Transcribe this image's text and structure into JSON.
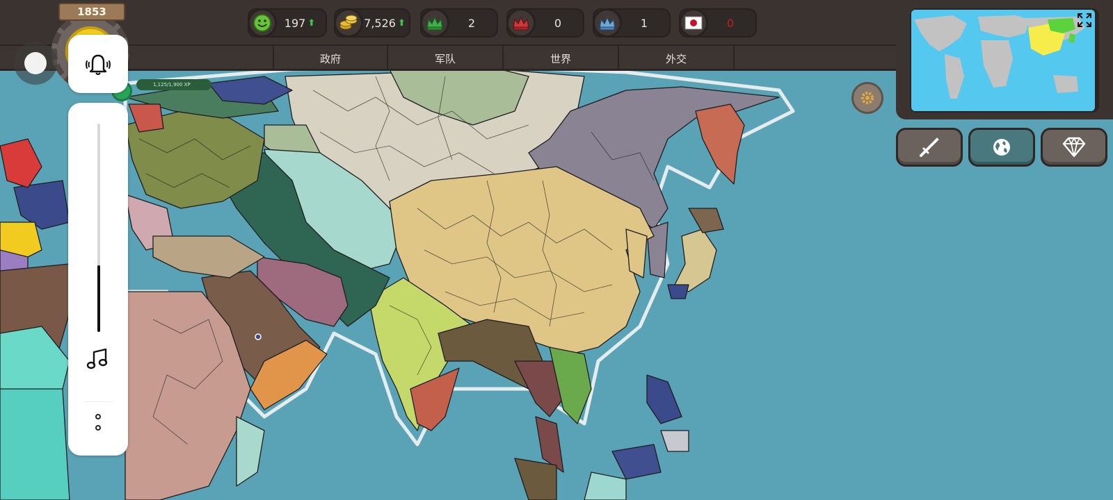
{
  "game": {
    "year": "1853"
  },
  "resources": [
    {
      "id": "happiness",
      "icon": "smiley-icon",
      "value": "197",
      "trend": "up"
    },
    {
      "id": "gold",
      "icon": "coins-icon",
      "value": "7,526",
      "trend": "up"
    },
    {
      "id": "green-crown",
      "icon": "green-crown-icon",
      "value": "2"
    },
    {
      "id": "red-crown",
      "icon": "red-crown-icon",
      "value": "0"
    },
    {
      "id": "blue-crown",
      "icon": "blue-crown-icon",
      "value": "1"
    },
    {
      "id": "flag",
      "icon": "japan-flag-icon",
      "value": "0",
      "alert": true
    }
  ],
  "tabs": [
    "政府",
    "军队",
    "世界",
    "外交"
  ],
  "xp": {
    "label": "1,125/1,900 XP"
  },
  "side_buttons": [
    {
      "id": "military",
      "icon": "sword-icon"
    },
    {
      "id": "world",
      "icon": "globe-icon"
    },
    {
      "id": "shop",
      "icon": "diamond-icon"
    }
  ],
  "system_overlay": {
    "volume_level": 0.32
  },
  "colors": {
    "ocean": "#5aa3b6",
    "bar": "#3a3330",
    "up_arrow": "#44c24a",
    "alert_red": "#c21d1d",
    "china": "#dfc586",
    "russia": "#d8d2c2",
    "east_russia": "#8a8394",
    "india": "#c5d96b",
    "japan": "#d5c692"
  }
}
